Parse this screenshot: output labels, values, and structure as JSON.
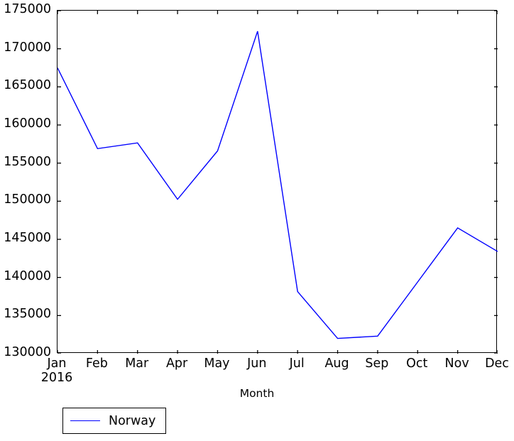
{
  "chart_data": {
    "type": "line",
    "title": "",
    "xlabel": "Month",
    "ylabel": "",
    "categories": [
      "Jan",
      "Feb",
      "Mar",
      "Apr",
      "May",
      "Jun",
      "Jul",
      "Aug",
      "Sep",
      "Oct",
      "Nov",
      "Dec"
    ],
    "x_axis_sublabel": "2016",
    "xtick_labels": [
      {
        "label": "Jan",
        "sub": "2016"
      },
      {
        "label": "Feb",
        "sub": ""
      },
      {
        "label": "Mar",
        "sub": ""
      },
      {
        "label": "Apr",
        "sub": ""
      },
      {
        "label": "May",
        "sub": ""
      },
      {
        "label": "Jun",
        "sub": ""
      },
      {
        "label": "Jul",
        "sub": ""
      },
      {
        "label": "Aug",
        "sub": ""
      },
      {
        "label": "Sep",
        "sub": ""
      },
      {
        "label": "Oct",
        "sub": ""
      },
      {
        "label": "Nov",
        "sub": ""
      },
      {
        "label": "Dec",
        "sub": ""
      }
    ],
    "ytick_labels": [
      "130000",
      "135000",
      "140000",
      "145000",
      "150000",
      "155000",
      "160000",
      "165000",
      "170000",
      "175000"
    ],
    "yticks": [
      130000,
      135000,
      140000,
      145000,
      150000,
      155000,
      160000,
      165000,
      170000,
      175000
    ],
    "ylim": [
      130000,
      175000
    ],
    "grid": false,
    "legend_position": "below-left",
    "series": [
      {
        "name": "Norway",
        "color": "#0000ff",
        "values": [
          167500,
          156900,
          157650,
          150250,
          156600,
          172300,
          138150,
          132000,
          132300,
          139400,
          146500,
          143400
        ]
      }
    ]
  },
  "legend": {
    "entries": [
      {
        "label": "Norway"
      }
    ]
  },
  "axes": {
    "xlabel": "Month"
  }
}
